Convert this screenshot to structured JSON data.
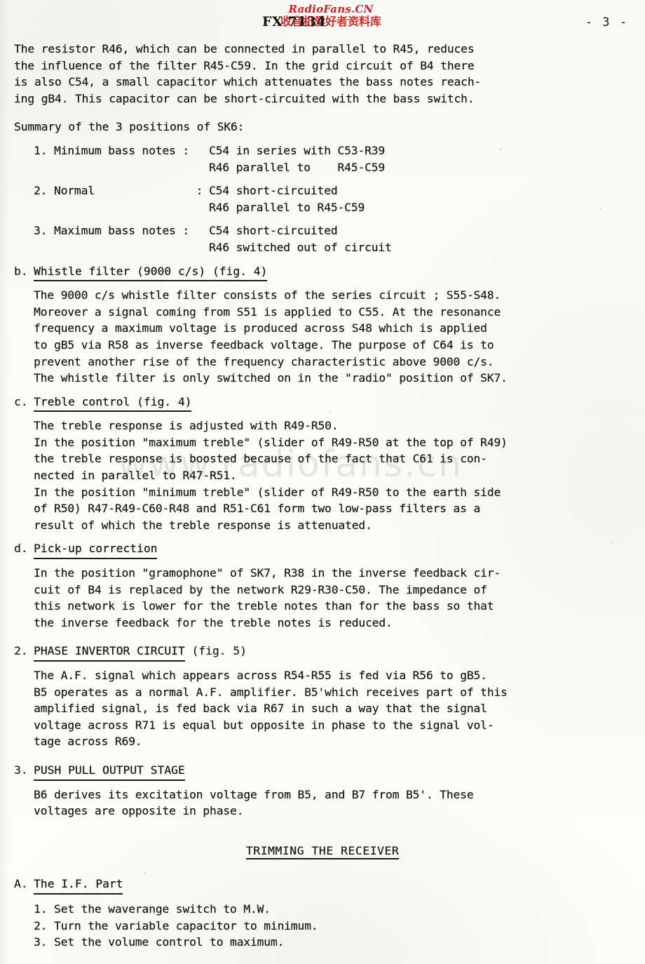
{
  "page": {
    "page_number": "- 3 -",
    "paper_color": "#fdfdfb",
    "ink_color": "#141414"
  },
  "watermarks": {
    "top_red_latin": "RadioFans.CN",
    "top_red_chinese": "收音机爱好者资料库",
    "top_black_model": "FX 7134",
    "red_color": "#cf1f26",
    "middle_ghost": "www.radiofans.cn"
  },
  "body": {
    "intro_paragraph": [
      "The resistor R46, which can be connected in parallel to R45, reduces",
      "the influence of the filter R45-C59. In the grid circuit of B4 there",
      "is also C54, a small capacitor which attenuates the bass notes reach-",
      "ing gB4. This capacitor can be short-circuited with the bass switch."
    ],
    "summary_lead": "Summary of the 3 positions of SK6:",
    "summary_items": [
      {
        "label": "1. Minimum bass notes :",
        "lines": [
          "C54 in series with C53-R39",
          "R46 parallel to    R45-C59"
        ]
      },
      {
        "label": "2. Normal               :",
        "lines": [
          "C54 short-circuited",
          "R46 parallel to R45-C59"
        ]
      },
      {
        "label": "3. Maximum bass notes :",
        "lines": [
          "C54 short-circuited",
          "R46 switched out of circuit"
        ]
      }
    ],
    "sections": [
      {
        "marker": "b.",
        "heading_underlined": "Whistle filter (9000 c/s) (fig. 4)",
        "heading_tail": "",
        "lines": [
          "The 9000 c/s whistle filter consists of the series circuit ; S55-S48.",
          "Moreover a signal coming from S51 is applied to C55. At the resonance",
          "frequency a maximum voltage is produced across S48 which is applied",
          "to gB5 via R58 as inverse feedback voltage. The purpose of C64 is to",
          "prevent another rise of the frequency characteristic above 9000 c/s.",
          "The whistle filter is only switched on in the \"radio\" position of SK7."
        ]
      },
      {
        "marker": "c.",
        "heading_underlined": "Treble control (fig. 4)",
        "heading_tail": "",
        "lines": [
          "The treble response is adjusted with R49-R50.",
          "In the position \"maximum treble\" (slider of R49-R50 at the top of R49)",
          "the treble response is boosted because of the fact that C61 is con-",
          "nected in parallel to R47-R51.",
          "In the position \"minimum treble\" (slider of R49-R50 to the earth side",
          "of R50) R47-R49-C60-R48 and R51-C61 form two low-pass filters as a",
          "result of which the treble response is attenuated."
        ]
      },
      {
        "marker": "d.",
        "heading_underlined": "Pick-up correction",
        "heading_tail": "",
        "lines": [
          "In the position \"gramophone\" of SK7, R38 in the inverse feedback cir-",
          "cuit of B4 is replaced by the network R29-R30-C50. The impedance of",
          "this network is lower for the treble notes than for the bass so that",
          "the inverse feedback for the treble notes is reduced."
        ]
      },
      {
        "marker": "2.",
        "heading_underlined": "PHASE INVERTOR CIRCUIT",
        "heading_tail": " (fig. 5)",
        "lines": [
          "The A.F. signal which appears across R54-R55 is fed via R56 to gB5.",
          "B5 operates as a normal A.F. amplifier. B5'which receives part of this",
          "amplified signal, is fed back via R67 in such a way that the signal",
          "voltage across R71 is equal but opposite in phase to the signal vol-",
          "tage across R69."
        ]
      },
      {
        "marker": "3.",
        "heading_underlined": "PUSH PULL OUTPUT STAGE",
        "heading_tail": "",
        "lines": [
          "B6 derives its excitation voltage from B5, and B7 from B5'. These",
          "voltages are opposite in phase."
        ]
      }
    ],
    "trimming_title": "TRIMMING THE RECEIVER",
    "trimming_section": {
      "marker": "A.",
      "heading_underlined": "The I.F. Part",
      "steps": [
        "1. Set the waverange switch to M.W.",
        "2. Turn the variable capacitor to minimum.",
        "3. Set the volume control to maximum."
      ]
    }
  }
}
